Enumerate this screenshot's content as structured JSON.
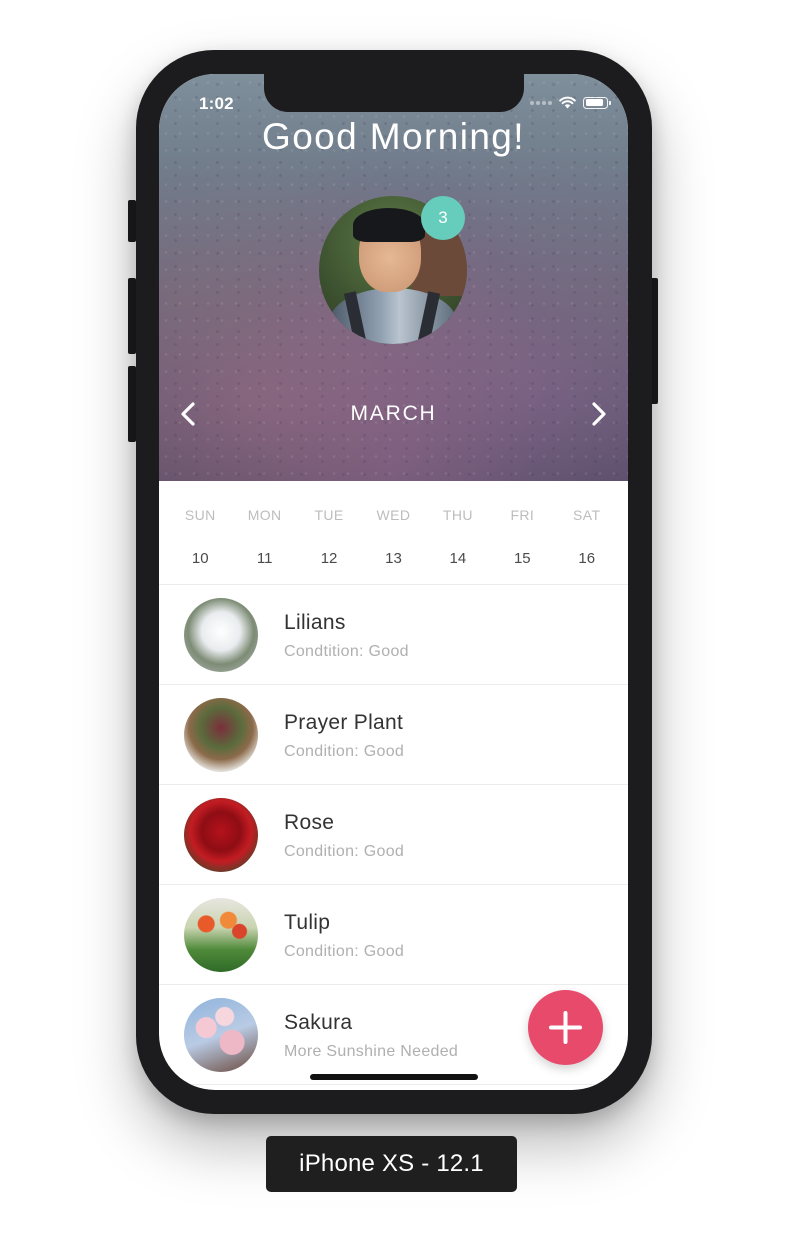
{
  "status_bar": {
    "time": "1:02",
    "battery_level": 0.85
  },
  "header": {
    "greeting": "Good Morning!",
    "notification_count": "3",
    "month": "MARCH"
  },
  "week": {
    "days": [
      "SUN",
      "MON",
      "TUE",
      "WED",
      "THU",
      "FRI",
      "SAT"
    ],
    "dates": [
      "10",
      "11",
      "12",
      "13",
      "14",
      "15",
      "16"
    ]
  },
  "plants": [
    {
      "name": "Lilians",
      "status": "Condtition: Good"
    },
    {
      "name": "Prayer Plant",
      "status": "Condition: Good"
    },
    {
      "name": "Rose",
      "status": "Condition: Good"
    },
    {
      "name": "Tulip",
      "status": "Condition: Good"
    },
    {
      "name": "Sakura",
      "status": "More Sunshine Needed"
    }
  ],
  "device_label": "iPhone XS - 12.1",
  "colors": {
    "badge": "#66ccbb",
    "fab": "#e84a6c",
    "primary_text": "#333333",
    "secondary_text": "#b0b0b0"
  }
}
